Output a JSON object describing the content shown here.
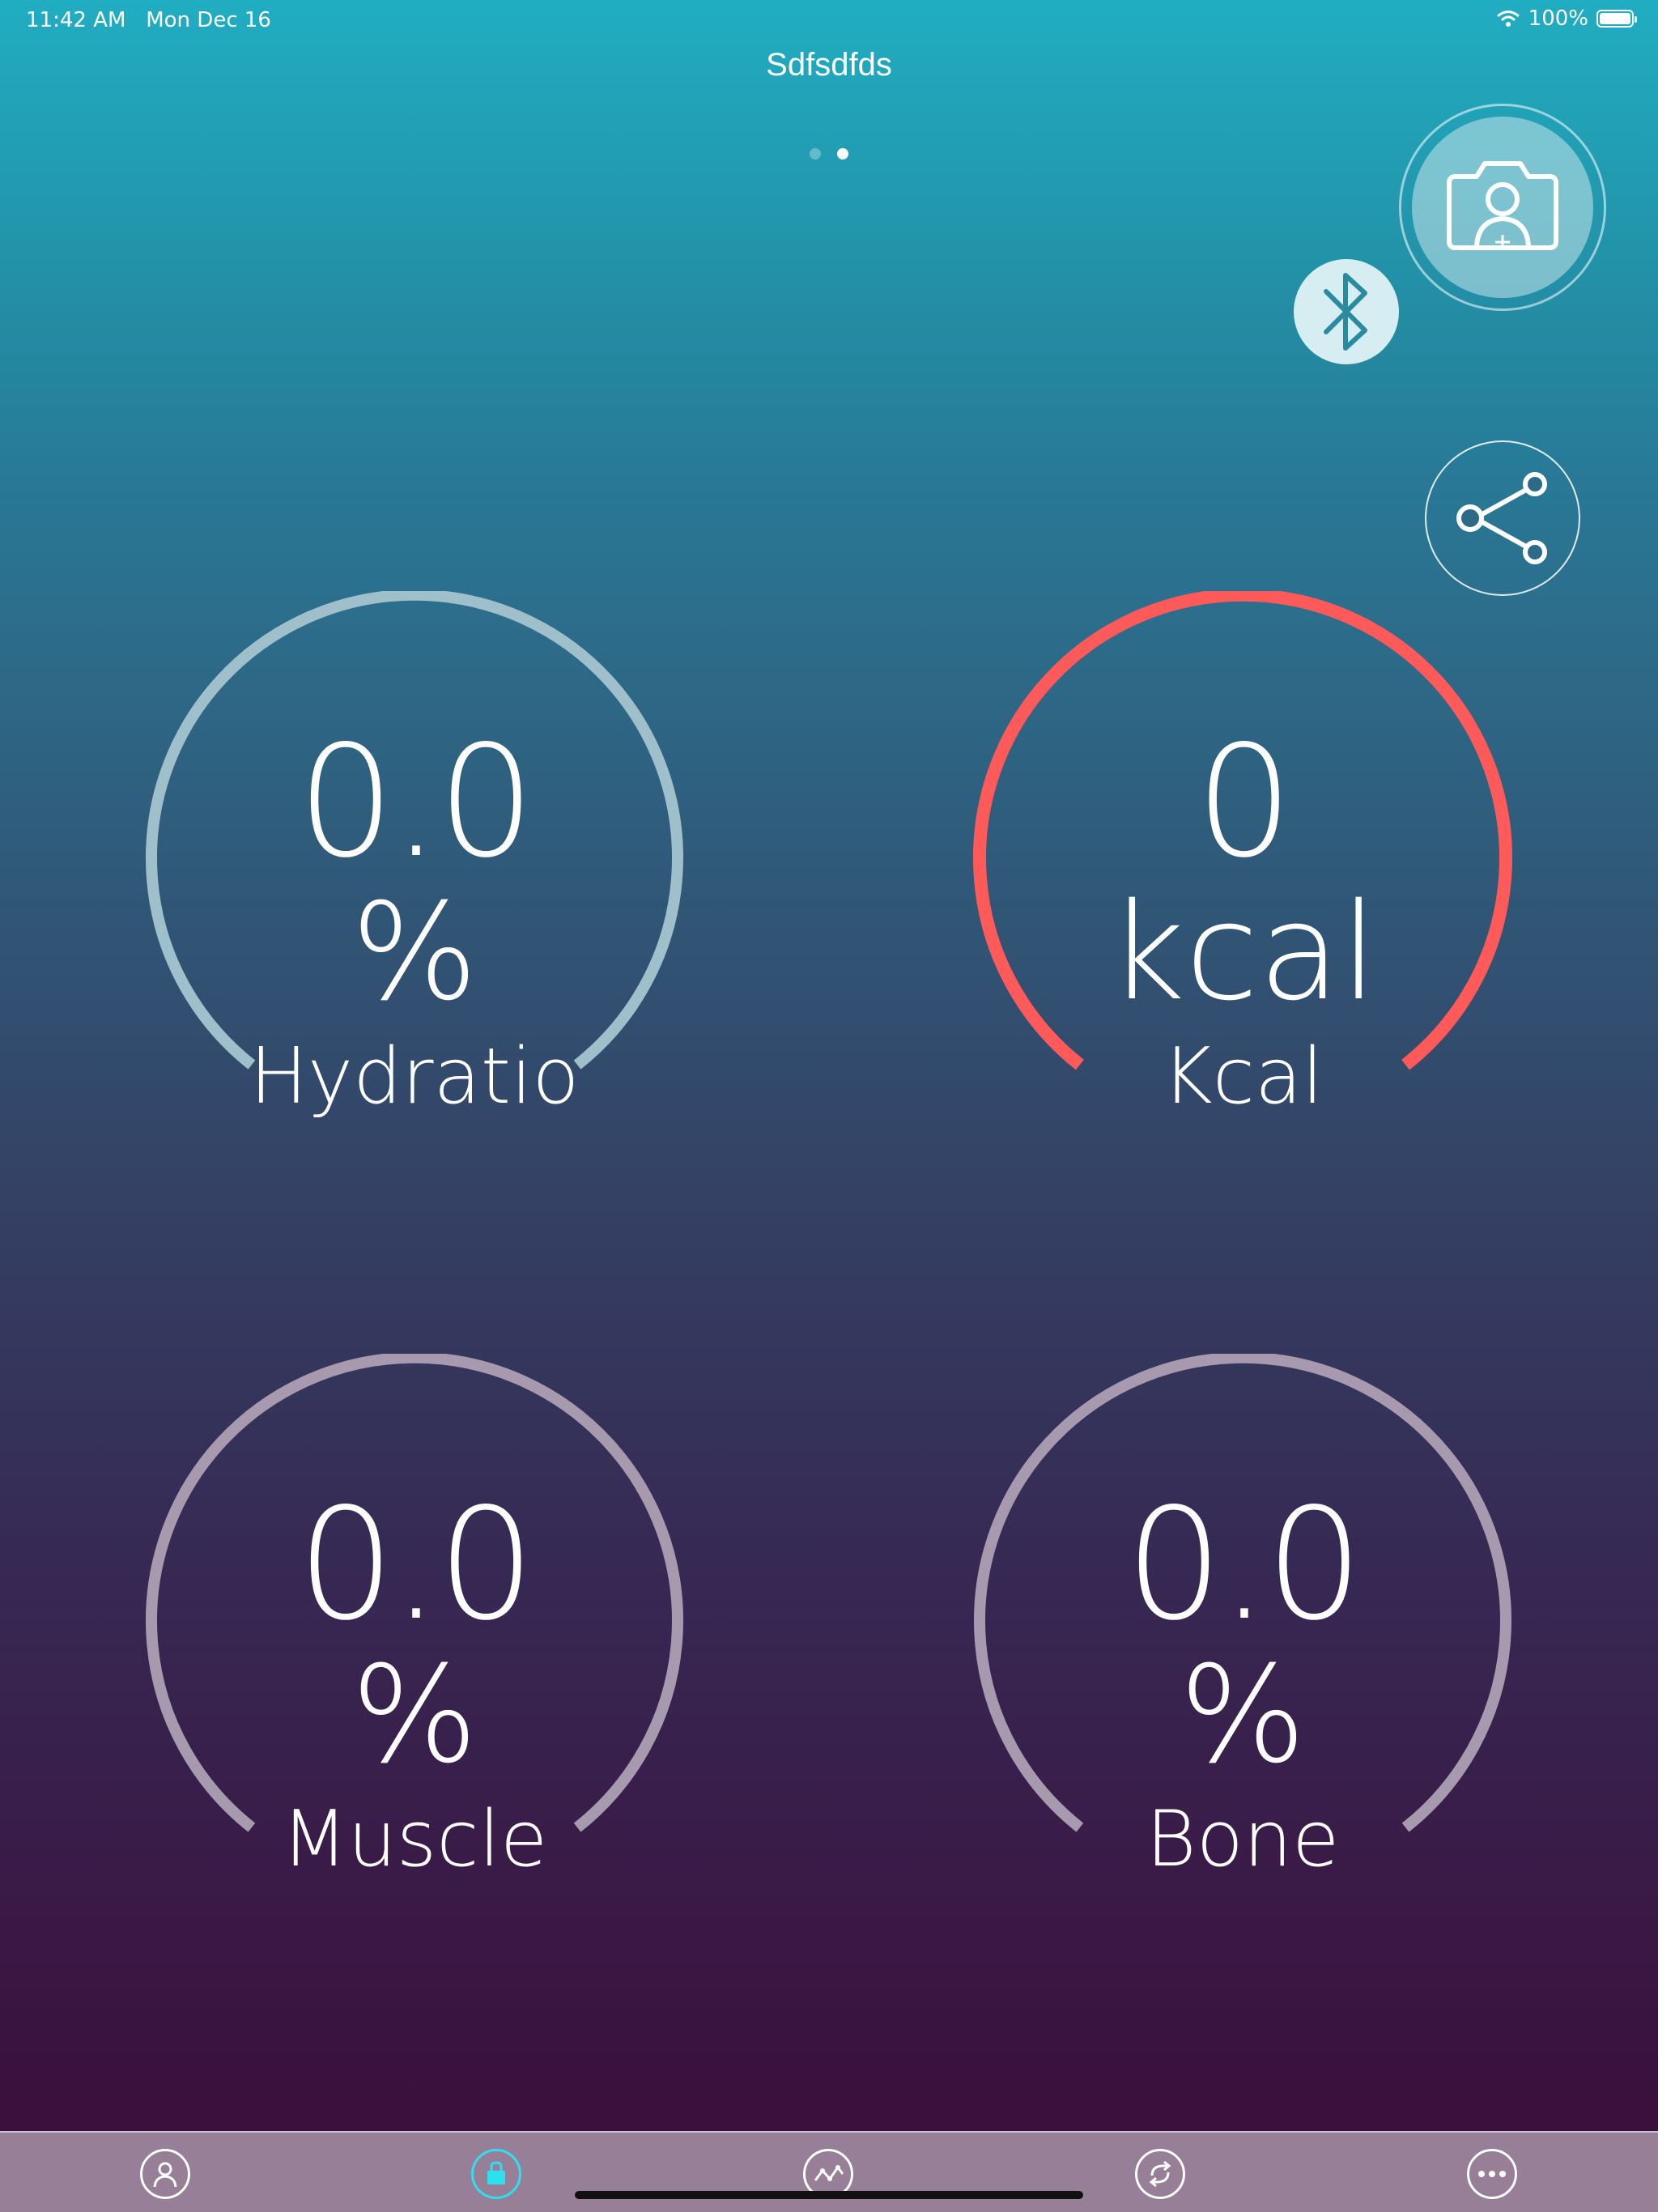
{
  "status": {
    "time": "11:42 AM",
    "date": "Mon Dec 16",
    "battery": "100%"
  },
  "header": {
    "title": "Sdfsdfds"
  },
  "pager": {
    "count": 2,
    "active": 2
  },
  "actions": {
    "camera_icon": "camera-user-icon",
    "bluetooth_icon": "bluetooth-icon",
    "share_icon": "share-icon"
  },
  "gauges": [
    {
      "value": "0.0",
      "unit": "%",
      "label": "Hydratio",
      "color": "#9fbfcb"
    },
    {
      "value": "0",
      "unit": "kcal",
      "label": "Kcal",
      "color": "#ff5a5a"
    },
    {
      "value": "0.0",
      "unit": "%",
      "label": "Muscle",
      "color": "#a89aae"
    },
    {
      "value": "0.0",
      "unit": "%",
      "label": "Bone",
      "color": "#a89aae"
    }
  ],
  "tabbar": {
    "items": [
      {
        "icon": "user-icon",
        "active": false
      },
      {
        "icon": "lock-icon",
        "active": true
      },
      {
        "icon": "trend-icon",
        "active": false
      },
      {
        "icon": "sync-icon",
        "active": false
      },
      {
        "icon": "more-icon",
        "active": false
      }
    ],
    "accent": "#2ee0ef"
  }
}
